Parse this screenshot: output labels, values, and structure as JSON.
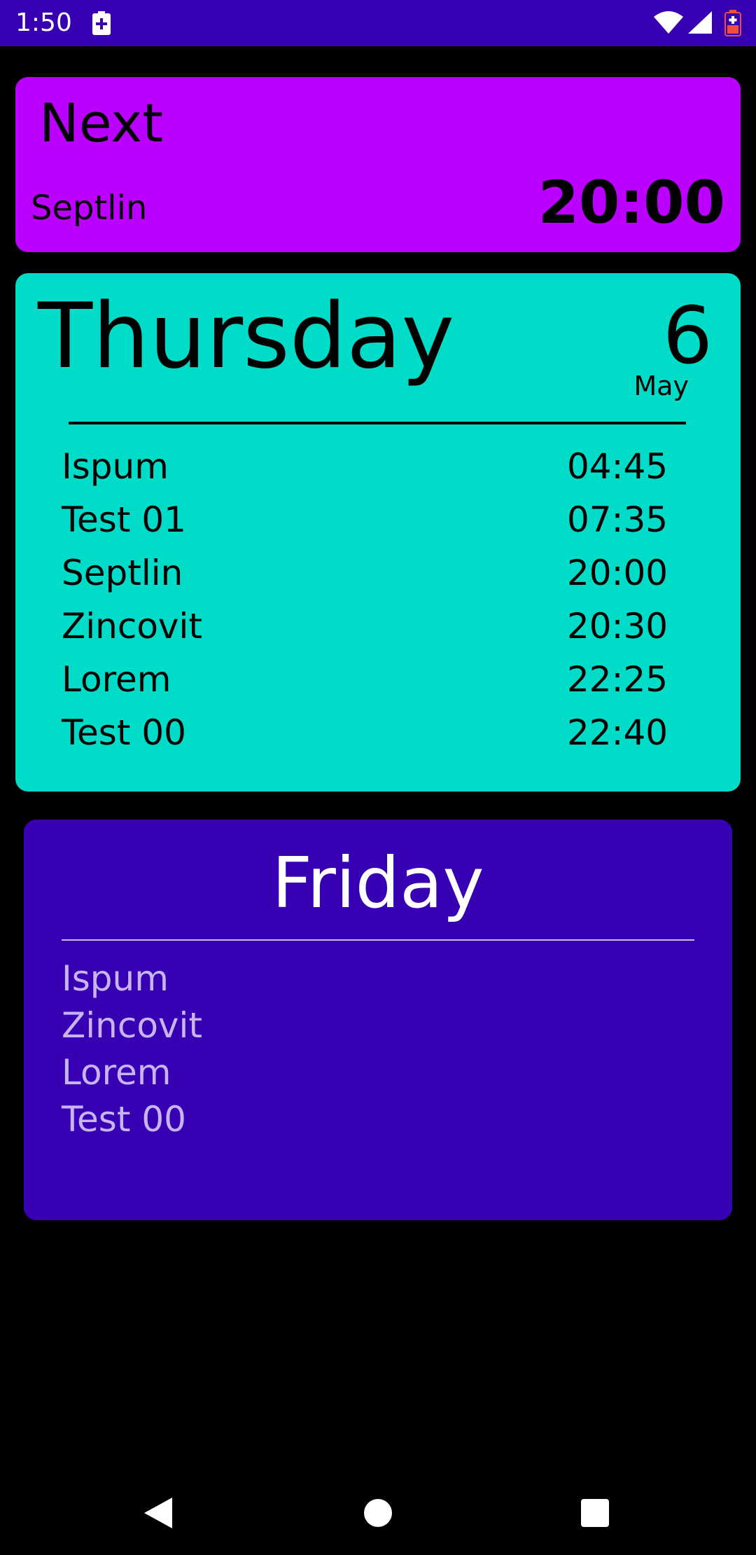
{
  "status_bar": {
    "time": "1:50",
    "icons": [
      "battery-saver-icon",
      "wifi-icon",
      "signal-icon",
      "battery-icon"
    ],
    "color": "#3700B3"
  },
  "next_card": {
    "title": "Next",
    "medicine": "Septlin",
    "time": "20:00",
    "color": "#BB00FF"
  },
  "today_card": {
    "day": "Thursday",
    "date": "6",
    "month": "May",
    "color": "#00DCC8",
    "items": [
      {
        "name": "Ispum",
        "time": "04:45"
      },
      {
        "name": "Test 01",
        "time": "07:35"
      },
      {
        "name": "Septlin",
        "time": "20:00"
      },
      {
        "name": "Zincovit",
        "time": "20:30"
      },
      {
        "name": "Lorem",
        "time": "22:25"
      },
      {
        "name": "Test 00",
        "time": "22:40"
      }
    ]
  },
  "tomorrow_card": {
    "day": "Friday",
    "color": "#3700B3",
    "items": [
      "Ispum",
      "Zincovit",
      "Lorem",
      "Test 00"
    ]
  },
  "nav_bar": {
    "buttons": [
      "back-icon",
      "home-icon",
      "recents-icon"
    ]
  }
}
